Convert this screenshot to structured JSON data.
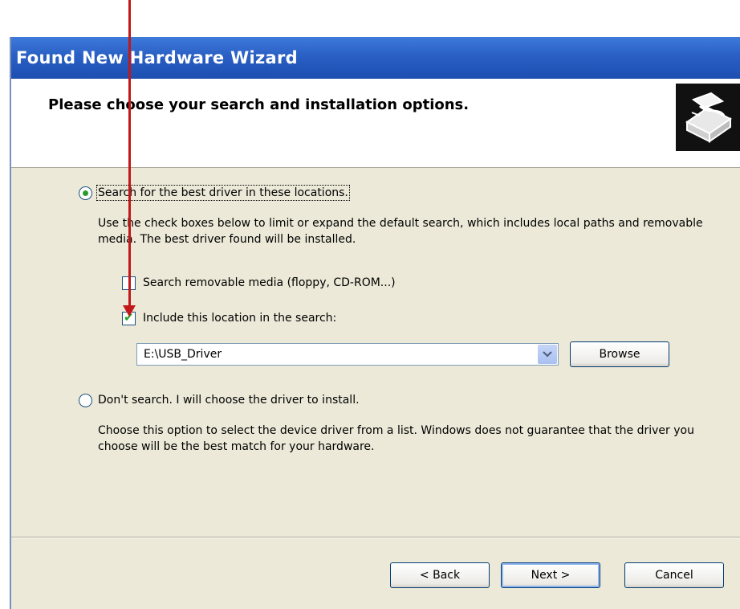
{
  "window": {
    "title": "Found New Hardware Wizard"
  },
  "header": {
    "title": "Please choose your search and installation options.",
    "icon": "hardware-wizard-icon"
  },
  "options": {
    "search": {
      "label": "Search for the best driver in these locations.",
      "selected": true,
      "description": "Use the check boxes below to limit or expand the default search, which includes local paths and removable media. The best driver found will be installed.",
      "removable_media": {
        "label": "Search removable media (floppy, CD-ROM...)",
        "checked": false
      },
      "include_location": {
        "label": "Include this location in the search:",
        "checked": true
      },
      "location_value": "E:\\USB_Driver",
      "browse_label": "Browse"
    },
    "dont_search": {
      "label": "Don't search. I will choose the driver to install.",
      "selected": false,
      "description": "Choose this option to select the device driver from a list. Windows does not guarantee that the driver you choose will be the best match for your hardware."
    }
  },
  "buttons": {
    "back": "< Back",
    "next": "Next >",
    "cancel": "Cancel"
  },
  "colors": {
    "annotation_arrow": "#c21818",
    "titlebar": "#2a5fc4"
  }
}
